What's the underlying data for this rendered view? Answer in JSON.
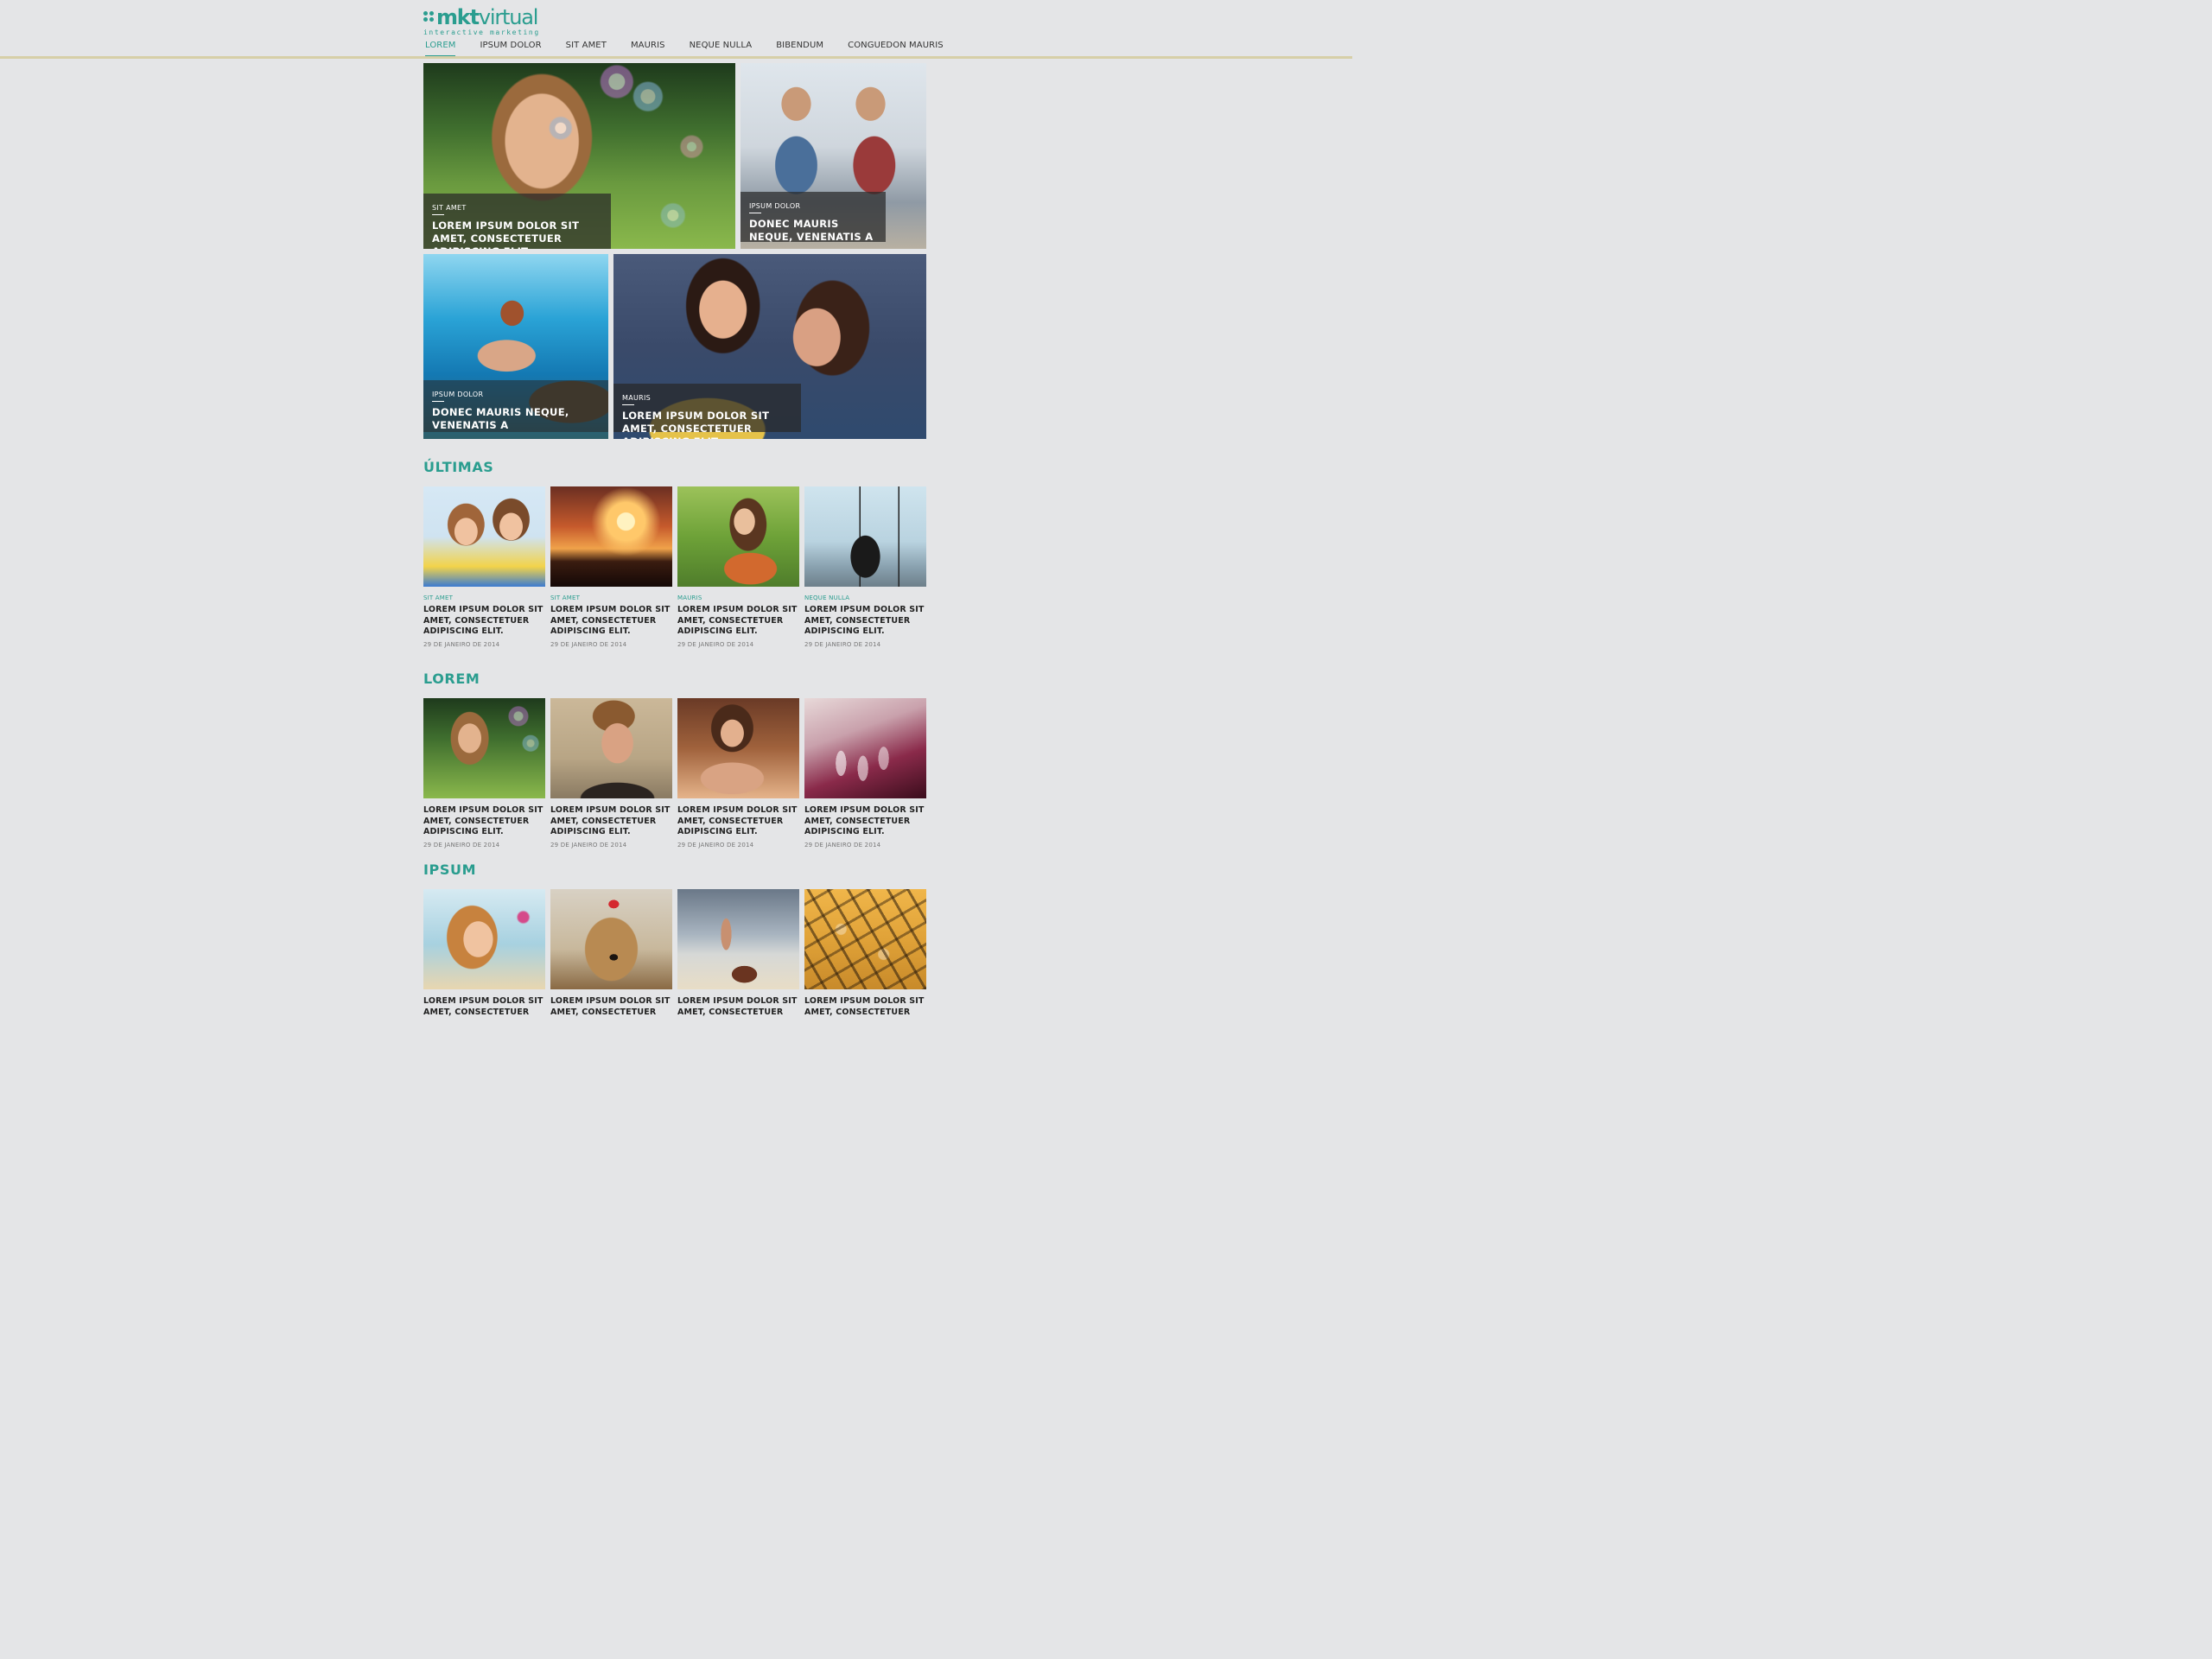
{
  "header": {
    "logo_bold": "mkt",
    "logo_light": "virtual",
    "logo_tagline": "interactive marketing"
  },
  "nav": [
    {
      "label": "LOREM",
      "active": true
    },
    {
      "label": "IPSUM DOLOR"
    },
    {
      "label": "SIT AMET"
    },
    {
      "label": "MAURIS"
    },
    {
      "label": "NEQUE NULLA"
    },
    {
      "label": "BIBENDUM"
    },
    {
      "label": "CONGUEDON MAURIS"
    }
  ],
  "hero": [
    {
      "category": "SIT AMET",
      "title": "LOREM IPSUM DOLOR SIT AMET, CONSECTETUER ADIPISCING ELIT"
    },
    {
      "category": "IPSUM DOLOR",
      "title": "DONEC MAURIS NEQUE, VENENATIS A"
    },
    {
      "category": "IPSUM DOLOR",
      "title": "DONEC MAURIS NEQUE, VENENATIS A"
    },
    {
      "category": "MAURIS",
      "title": "LOREM IPSUM DOLOR SIT AMET, CONSECTETUER ADIPISCING ELIT"
    }
  ],
  "sections": {
    "ultimas": {
      "title": "ÚLTIMAS",
      "items": [
        {
          "category": "SIT AMET",
          "title": "LOREM IPSUM DOLOR SIT AMET, CONSECTETUER ADIPISCING ELIT.",
          "date": "29 DE JANEIRO DE 2014"
        },
        {
          "category": "SIT AMET",
          "title": "LOREM IPSUM DOLOR SIT AMET, CONSECTETUER ADIPISCING ELIT.",
          "date": "29 DE JANEIRO DE 2014"
        },
        {
          "category": "MAURIS",
          "title": "LOREM IPSUM DOLOR SIT AMET, CONSECTETUER ADIPISCING ELIT.",
          "date": "29 DE JANEIRO DE 2014"
        },
        {
          "category": "NEQUE NULLA",
          "title": "LOREM IPSUM DOLOR SIT AMET, CONSECTETUER ADIPISCING ELIT.",
          "date": "29 DE JANEIRO DE 2014"
        }
      ]
    },
    "lorem": {
      "title": "LOREM",
      "items": [
        {
          "title": "LOREM IPSUM DOLOR SIT AMET, CONSECTETUER ADIPISCING ELIT.",
          "date": "29 DE JANEIRO DE 2014"
        },
        {
          "title": "LOREM IPSUM DOLOR SIT AMET, CONSECTETUER ADIPISCING ELIT.",
          "date": "29 DE JANEIRO DE 2014"
        },
        {
          "title": "LOREM IPSUM DOLOR SIT AMET, CONSECTETUER ADIPISCING ELIT.",
          "date": "29 DE JANEIRO DE 2014"
        },
        {
          "title": "LOREM IPSUM DOLOR SIT AMET, CONSECTETUER ADIPISCING ELIT.",
          "date": "29 DE JANEIRO DE 2014"
        }
      ]
    },
    "ipsum": {
      "title": "IPSUM",
      "items": [
        {
          "title": "LOREM IPSUM DOLOR SIT AMET, CONSECTETUER"
        },
        {
          "title": "LOREM IPSUM DOLOR SIT AMET, CONSECTETUER"
        },
        {
          "title": "LOREM IPSUM DOLOR SIT AMET, CONSECTETUER"
        },
        {
          "title": "LOREM IPSUM DOLOR SIT AMET, CONSECTETUER"
        }
      ]
    }
  },
  "colors": {
    "accent": "#2a9d8f",
    "nav_rule": "#d6cfa8",
    "background": "#e4e5e7"
  }
}
